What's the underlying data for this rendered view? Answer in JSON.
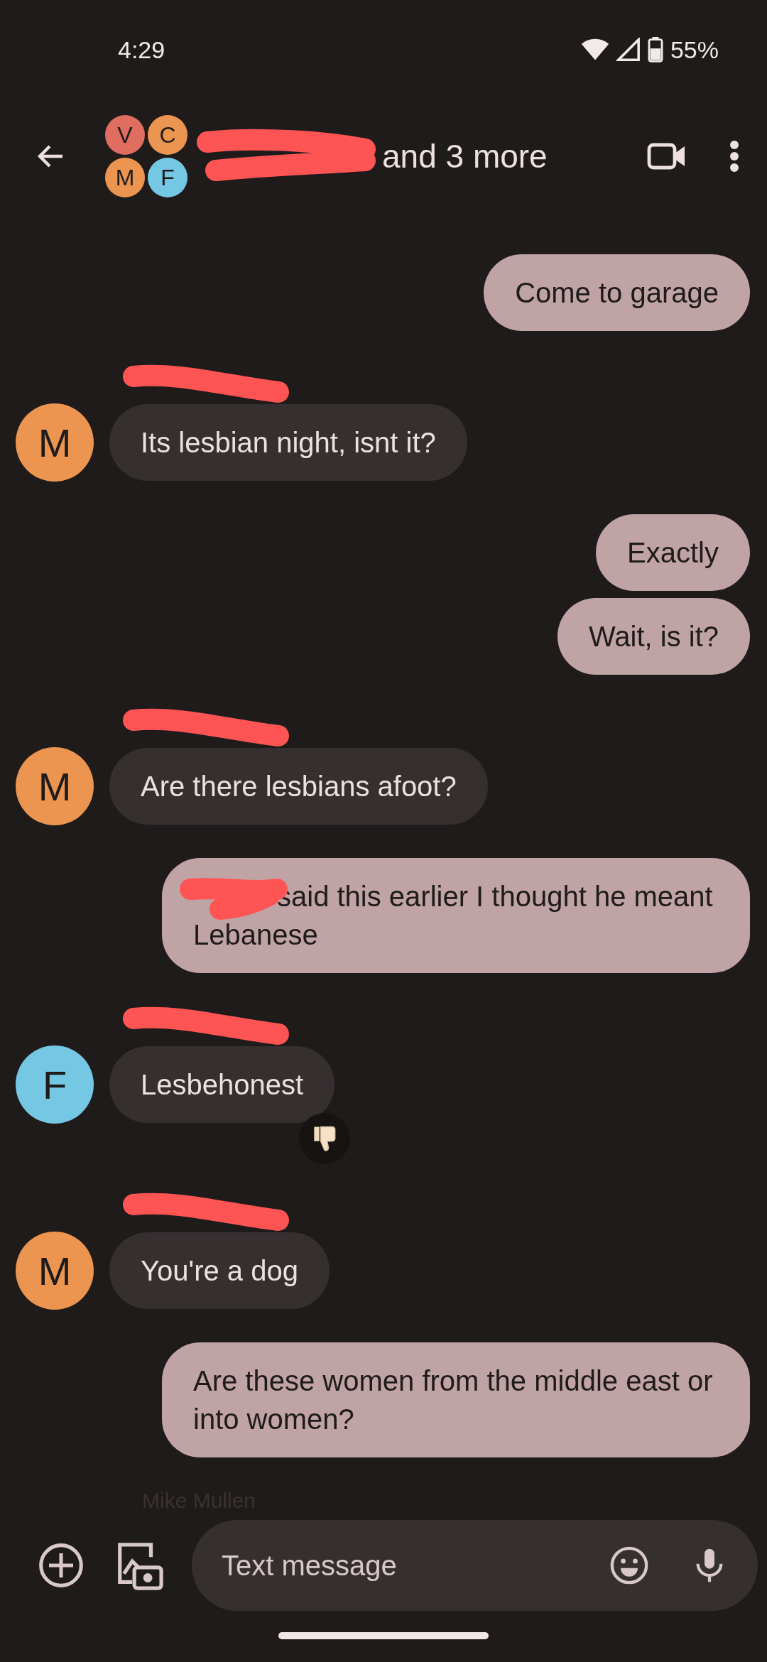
{
  "status_bar": {
    "time": "4:29",
    "battery": "55%"
  },
  "header": {
    "avatars": [
      {
        "letter": "V",
        "color": "#df6d60"
      },
      {
        "letter": "C",
        "color": "#ec9550"
      },
      {
        "letter": "M",
        "color": "#ec9550"
      },
      {
        "letter": "F",
        "color": "#74c8e3"
      }
    ],
    "name_redacted": true,
    "title": "and 3 more"
  },
  "messages": [
    {
      "kind": "sent",
      "redacted": false,
      "text": "Come to garage"
    },
    {
      "kind": "received",
      "avatar": "M",
      "color": "#ec9550",
      "name_redacted": true,
      "text": "Its lesbian night, isnt it?",
      "reaction": false
    },
    {
      "kind": "sent",
      "redacted": false,
      "text": "Exactly"
    },
    {
      "kind": "sent",
      "redacted": false,
      "text": "Wait, is it?"
    },
    {
      "kind": "received",
      "avatar": "M",
      "color": "#ec9550",
      "name_redacted": true,
      "text": "Are there lesbians afoot?",
      "reaction": false
    },
    {
      "kind": "sent",
      "redacted": true,
      "text": "said this earlier I thought he meant Lebanese"
    },
    {
      "kind": "received",
      "avatar": "F",
      "color": "#74c8e3",
      "name_redacted": true,
      "text": "Lesbehonest",
      "reaction": true
    },
    {
      "kind": "received",
      "avatar": "M",
      "color": "#ec9550",
      "name_redacted": true,
      "text": "You're a dog",
      "reaction": false
    },
    {
      "kind": "sent",
      "redacted": false,
      "text": "Are these women from the middle east or into women?"
    },
    {
      "kind": "sender_label",
      "text": "Mike Mullen"
    }
  ],
  "composer": {
    "placeholder": "Text message"
  }
}
